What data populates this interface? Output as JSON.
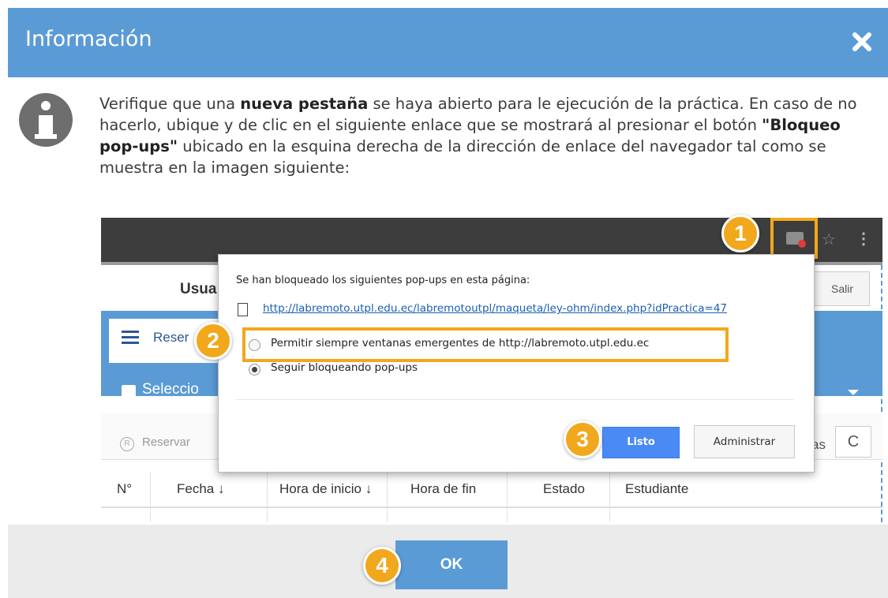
{
  "dialog": {
    "title": "Información",
    "message_parts": [
      "Verifique que una ",
      "nueva pestaña",
      " se haya abierto para le ejecución de la práctica. En caso de no hacerlo, ubique y de clic en el siguiente enlace que se mostrará al presionar el botón ",
      "\"Bloqueo pop-ups\"",
      " ubicado en la esquina derecha de la dirección de enlace del navegador tal como se muestra en la imagen siguiente:"
    ],
    "ok_label": "OK"
  },
  "screenshot": {
    "user_label": "Usua",
    "logout_label": "Salir",
    "reserve_tab_label": "Reser",
    "select_label": "Seleccio",
    "reserve_button_label": "Reservar",
    "reserve_icon_text": "R",
    "toolbar_partial_label": "as",
    "refresh_label": "C",
    "columns": [
      "N°",
      "Fecha",
      "Hora de inicio",
      "Hora de fin",
      "Estado",
      "Estudiante"
    ],
    "column_sort_marks": [
      "",
      "↓",
      "↓",
      "",
      "",
      ""
    ]
  },
  "popup": {
    "heading": "Se han bloqueado los siguientes pop-ups en esta página:",
    "url": "http://labremoto.utpl.edu.ec/labremotoutpl/maqueta/ley-ohm/index.php?idPractica=47",
    "option_allow": "Permitir siempre ventanas emergentes de http://labremoto.utpl.edu.ec",
    "option_block": "Seguir bloqueando pop-ups",
    "selected_option": "option_block",
    "done_label": "Listo",
    "manage_label": "Administrar"
  },
  "steps": [
    "1",
    "2",
    "3",
    "4"
  ],
  "icons": {
    "close": "close-icon",
    "info": "info-icon",
    "popup_blocked": "popup-blocked-icon",
    "bookmark": "star-icon",
    "menu": "more-vert-icon",
    "list": "list-icon",
    "calendar": "calendar-icon",
    "document": "document-icon"
  },
  "colors": {
    "header": "#5b9bd5",
    "highlight": "#f2a81c",
    "listo_button": "#4a8af4",
    "footer": "#ebebeb"
  }
}
